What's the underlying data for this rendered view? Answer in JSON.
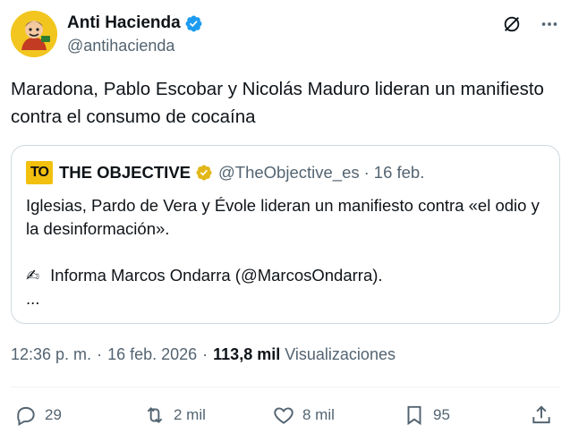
{
  "author": {
    "display_name": "Anti Hacienda",
    "handle": "@antihacienda",
    "avatar_icon": "cartoon-avatar",
    "verified_icon": "blue-verified-badge"
  },
  "header_icons": [
    "grok-icon",
    "more-icon"
  ],
  "tweet": {
    "text": "Maradona, Pablo Escobar y Nicolás Maduro lideran un manifiesto contra el consumo de cocaína"
  },
  "quote": {
    "logo_text": "TO",
    "display_name": "THE OBJECTIVE",
    "handle": "@TheObjective_es",
    "separator": "·",
    "date": "16 feb.",
    "line1": "Iglesias, Pardo de Vera y Évole lideran un manifiesto contra «el odio y la desinformación».",
    "emoji": "✍",
    "line2": "Informa Marcos Ondarra (@MarcosOndarra).",
    "ellipsis": "..."
  },
  "meta": {
    "time": "12:36 p. m.",
    "separator": "·",
    "date": "16 feb. 2026",
    "views_count": "113,8 mil",
    "views_label": "Visualizaciones"
  },
  "actions": {
    "replies": "29",
    "reposts": "2 mil",
    "likes": "8 mil",
    "bookmarks": "95"
  },
  "colors": {
    "verified_blue": "#1d9bf0",
    "gold_badge": "#e2b719",
    "muted_text": "#536471",
    "border": "#cfd9de"
  }
}
